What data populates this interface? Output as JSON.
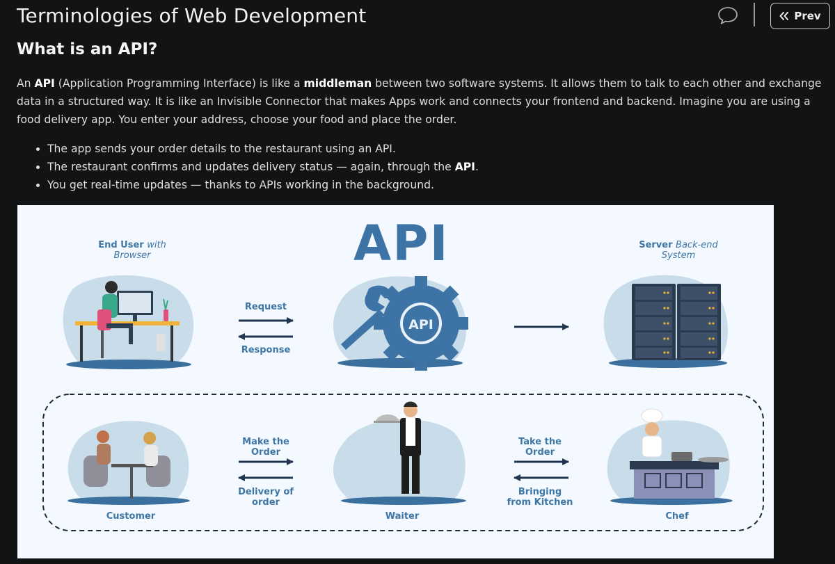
{
  "header": {
    "title": "Terminologies of Web Development",
    "prev_label": "Prev"
  },
  "article": {
    "heading": "What is an API?",
    "intro": {
      "line1_a": "An ",
      "line1_api": "API",
      "line1_b": " (Application Programming Interface) is like a ",
      "line1_middleman": "middleman",
      "line1_c": " between two software systems. It allows them to talk to each other and exchange",
      "line2": "data in a structured way. It is like an Invisible Connector that makes Apps work and connects your frontend and backend. Imagine you are using a",
      "line3": "food delivery app. You enter your address, choose your food and place the order."
    },
    "bullets": [
      {
        "text": "The app sends your order details to the restaurant using an API."
      },
      {
        "text_a": "The restaurant confirms and updates delivery status — again, through the ",
        "text_bold": "API",
        "text_b": "."
      },
      {
        "text": "You get real-time updates — thanks to APIs working in the background."
      }
    ]
  },
  "figure": {
    "big_title": "API",
    "gear_label": "API",
    "end_user_a": "End User ",
    "end_user_b": "with",
    "end_user_c": "Browser",
    "server_a": "Server ",
    "server_b": "Back-end",
    "server_c": "System",
    "request": "Request",
    "response": "Response",
    "make_order_1": "Make the",
    "make_order_2": "Order",
    "delivery_1": "Delivery of",
    "delivery_2": "order",
    "take_order_1": "Take the",
    "take_order_2": "Order",
    "bringing_1": "Bringing",
    "bringing_2": "from Kitchen",
    "customer": "Customer",
    "waiter": "Waiter",
    "chef": "Chef"
  },
  "colors": {
    "page_bg": "#111315",
    "figure_bg": "#f3f9fe",
    "accent_blue": "#3d74a5",
    "navy": "#1f3550"
  },
  "icons": {
    "comment": "speech-bubble-icon",
    "prev": "double-chevron-left-icon"
  }
}
